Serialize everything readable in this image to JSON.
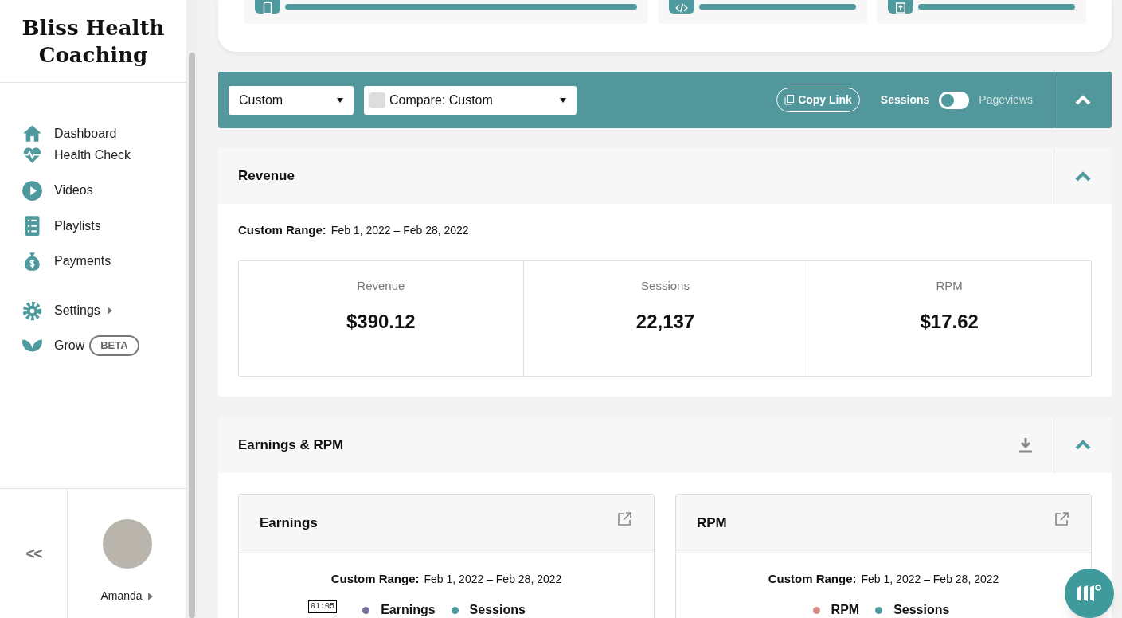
{
  "sidebar": {
    "brand": "Bliss Health Coaching",
    "items": [
      {
        "label": "Dashboard",
        "selected": false
      },
      {
        "label": "Health Check",
        "selected": false
      },
      {
        "label": "Videos",
        "selected": false
      },
      {
        "label": "Playlists",
        "selected": false
      },
      {
        "label": "Payments",
        "selected": false
      },
      {
        "label": "Settings",
        "selected": false,
        "submenu": true
      },
      {
        "label": "Grow",
        "selected": false,
        "badge": "BETA"
      }
    ],
    "collapse": "<<",
    "user": "Amanda"
  },
  "top_tiles": [
    {
      "level": 1
    },
    {
      "level": 1
    },
    {
      "level": 1
    }
  ],
  "toolbar": {
    "range": "Custom",
    "compare": "Compare: Custom",
    "copy_link": "Copy Link",
    "toggle_left": "Sessions",
    "toggle_right": "Pageviews",
    "on": false
  },
  "revenue": {
    "title": "Revenue",
    "range_label": "Custom Range:",
    "range": "Feb 1, 2022 – Feb 28, 2022",
    "stats": [
      {
        "label": "Revenue",
        "value": "$390.12"
      },
      {
        "label": "Sessions",
        "value": "22,137"
      },
      {
        "label": "RPM",
        "value": "$17.62"
      }
    ]
  },
  "earnings_rpm": {
    "title": "Earnings & RPM",
    "panels": [
      {
        "title": "Earnings",
        "range_label": "Custom Range:",
        "range": "Feb 1, 2022 – Feb 28, 2022",
        "tooltip": "01:05",
        "legend": [
          {
            "name": "Earnings",
            "color": "#7b6f9c"
          },
          {
            "name": "Sessions",
            "color": "#4e9a9e"
          }
        ]
      },
      {
        "title": "RPM",
        "range_label": "Custom Range:",
        "range": "Feb 1, 2022 – Feb 28, 2022",
        "legend": [
          {
            "name": "RPM",
            "color": "#d48a8a"
          },
          {
            "name": "Sessions",
            "color": "#4e9a9e"
          }
        ]
      }
    ]
  }
}
